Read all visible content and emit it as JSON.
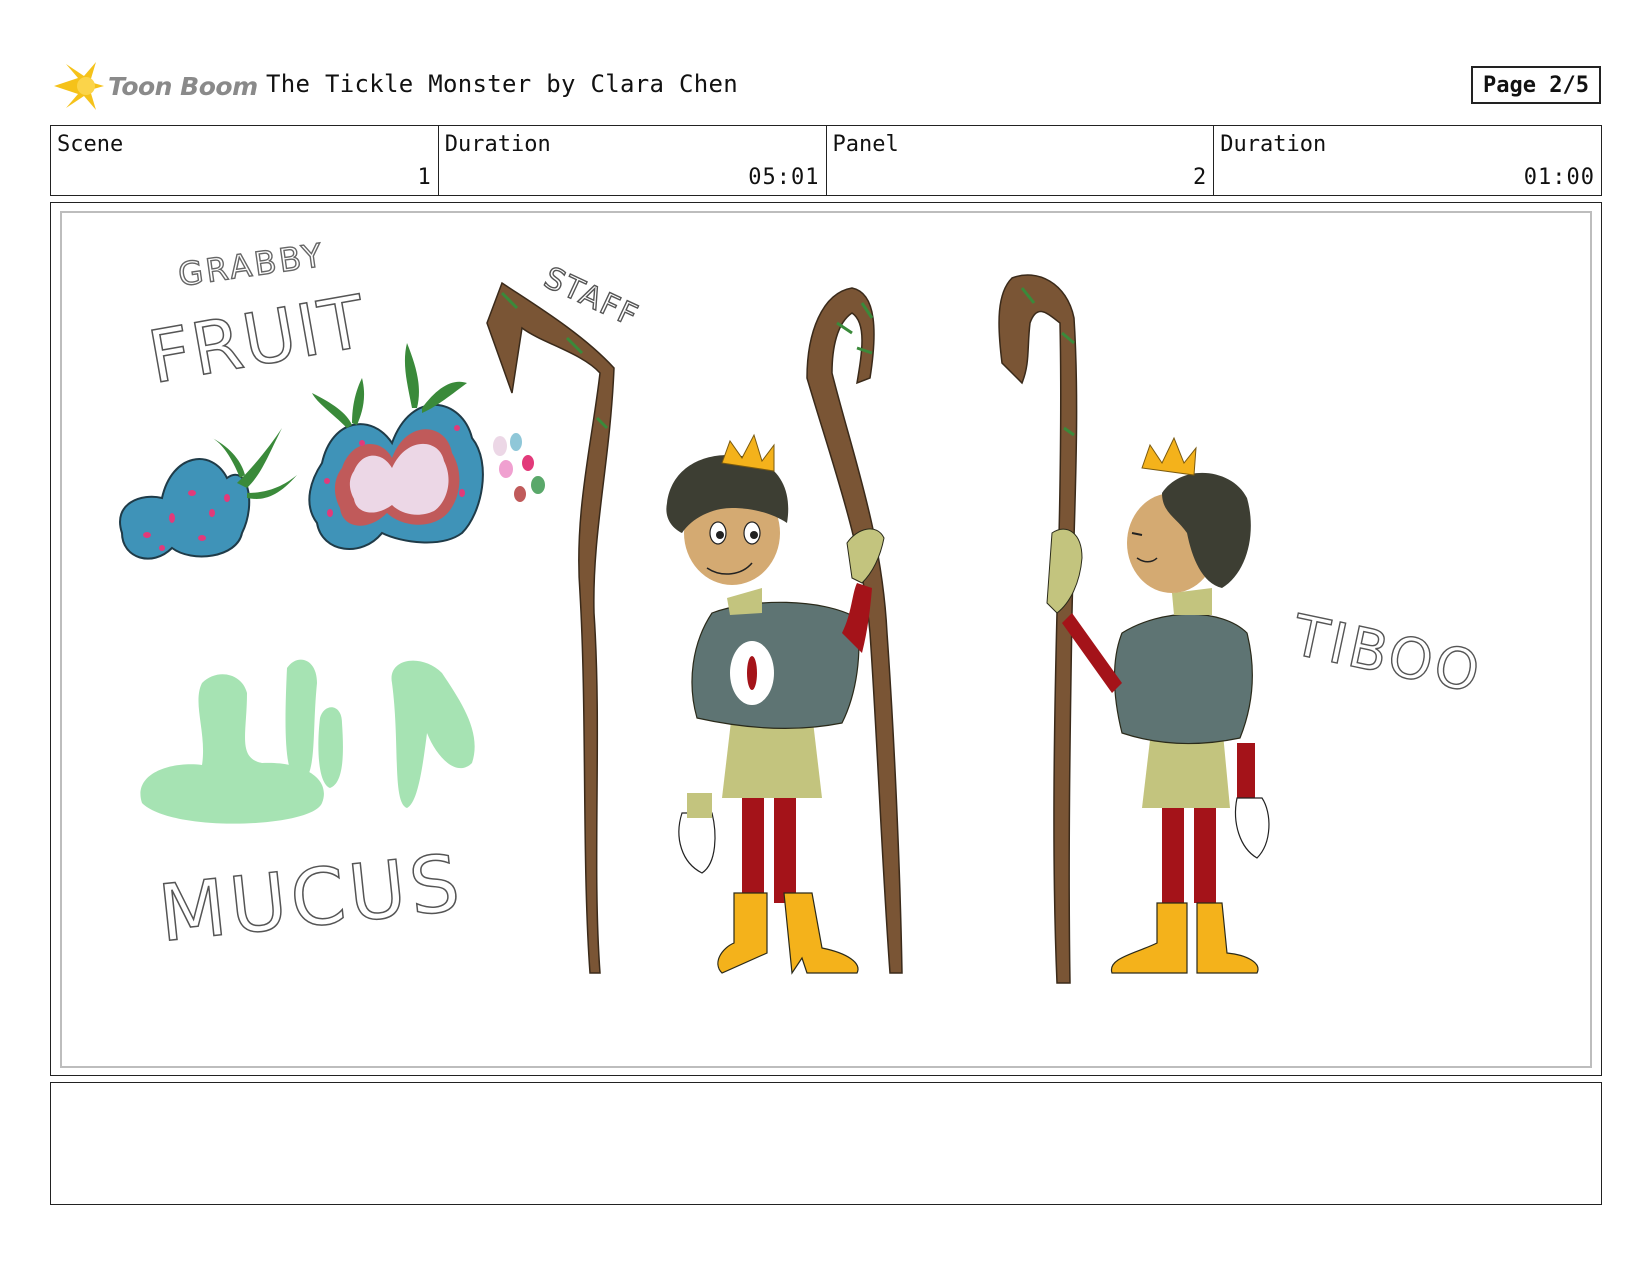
{
  "header": {
    "logo_text": "Toon Boom",
    "title": "The Tickle Monster by Clara Chen",
    "page_label": "Page 2/5"
  },
  "info": {
    "cells": [
      {
        "label": "Scene",
        "value": "1"
      },
      {
        "label": "Duration",
        "value": "05:01"
      },
      {
        "label": "Panel",
        "value": "2"
      },
      {
        "label": "Duration",
        "value": "01:00"
      }
    ]
  },
  "panel": {
    "sketch_labels": {
      "grabby": "GRABBY",
      "fruit": "FRUIT",
      "staff": "STAFF",
      "mucus": "MUCUS",
      "tiboo": "TIBOO"
    }
  },
  "notes": {
    "text": ""
  },
  "colors": {
    "logo_star": "#f5c21a",
    "fruit_blue": "#3f93b8",
    "fruit_spot": "#e23a7a",
    "leaf_green": "#3a8a3a",
    "mucus_green": "#a6e3b3",
    "staff_brown": "#7a5535",
    "cape_grey": "#5e7473",
    "tunic_olive": "#c3c47e",
    "leg_red": "#a41319",
    "boot_yellow": "#f4b21b",
    "crown_gold": "#f4b21b",
    "hair_dark": "#3d3e33",
    "skin_tan": "#d4aa72"
  }
}
